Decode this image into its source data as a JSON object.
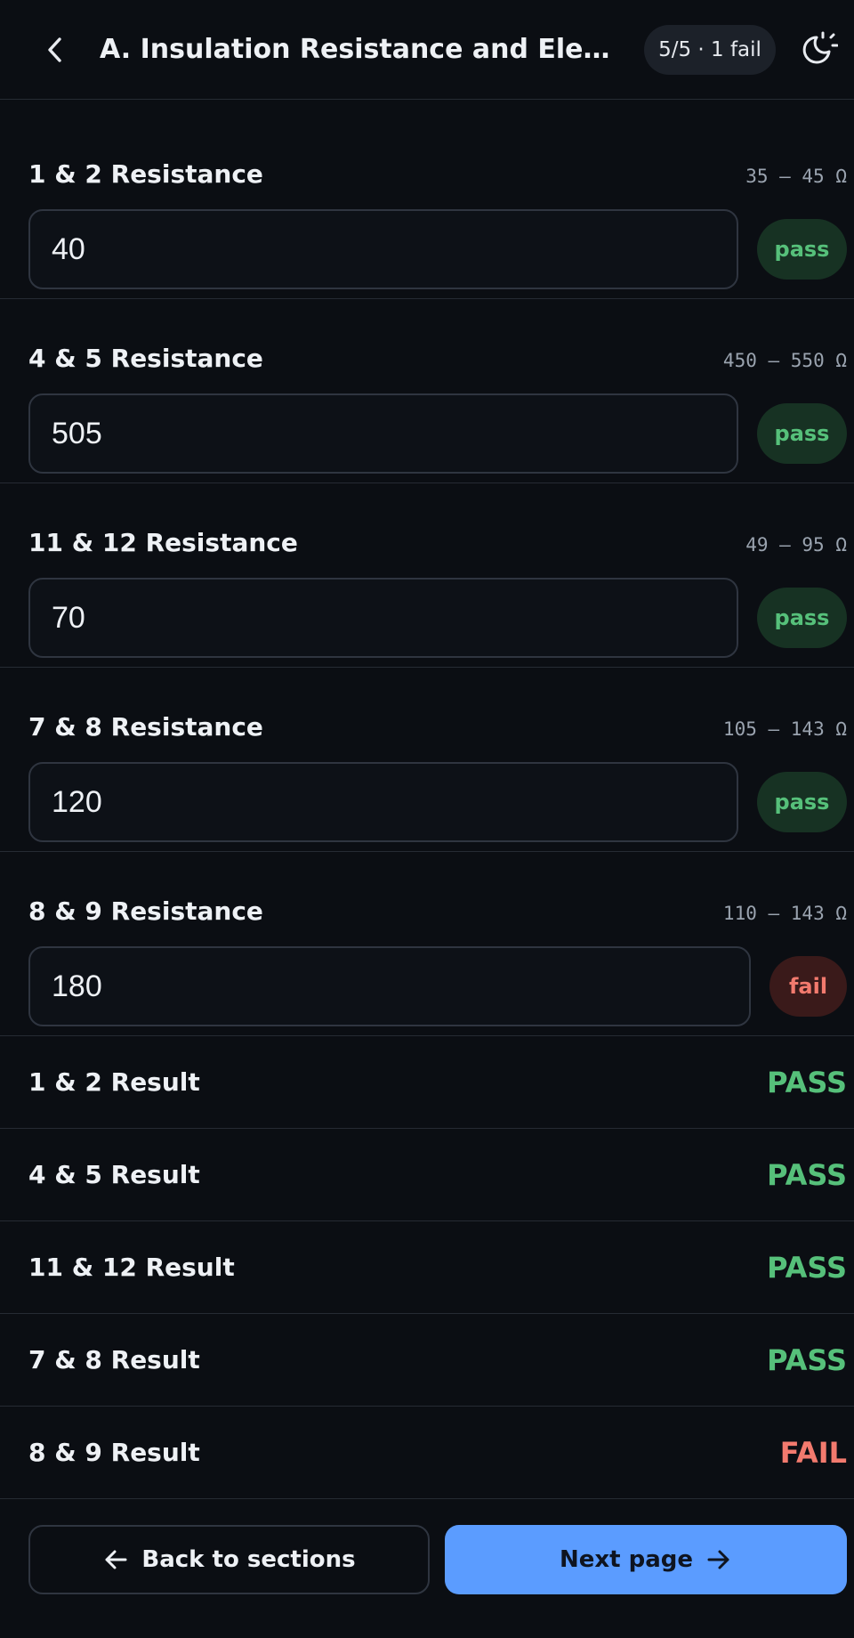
{
  "header": {
    "title": "A. Insulation Resistance and Electrical ...",
    "status": "5/5 · 1 fail",
    "back_icon": "chevron-left-icon",
    "theme_icon": "theme-toggle-icon"
  },
  "measurements": [
    {
      "label": "1 & 2 Resistance",
      "range": "35 – 45 Ω",
      "value": "40",
      "status": "pass"
    },
    {
      "label": "4 & 5 Resistance",
      "range": "450 – 550 Ω",
      "value": "505",
      "status": "pass"
    },
    {
      "label": "11 & 12 Resistance",
      "range": "49 – 95 Ω",
      "value": "70",
      "status": "pass"
    },
    {
      "label": "7 & 8 Resistance",
      "range": "105 – 143 Ω",
      "value": "120",
      "status": "pass"
    },
    {
      "label": "8 & 9 Resistance",
      "range": "110 – 143 Ω",
      "value": "180",
      "status": "fail"
    }
  ],
  "results": [
    {
      "label": "1 & 2 Result",
      "value": "PASS"
    },
    {
      "label": "4 & 5 Result",
      "value": "PASS"
    },
    {
      "label": "11 & 12 Result",
      "value": "PASS"
    },
    {
      "label": "7 & 8 Result",
      "value": "PASS"
    },
    {
      "label": "8 & 9 Result",
      "value": "FAIL"
    }
  ],
  "footer": {
    "back_label": "Back to sections",
    "next_label": "Next page"
  },
  "colors": {
    "background": "#0b0e13",
    "pass": "#56c07a",
    "fail": "#f27a6e",
    "accent": "#5b9cff"
  }
}
